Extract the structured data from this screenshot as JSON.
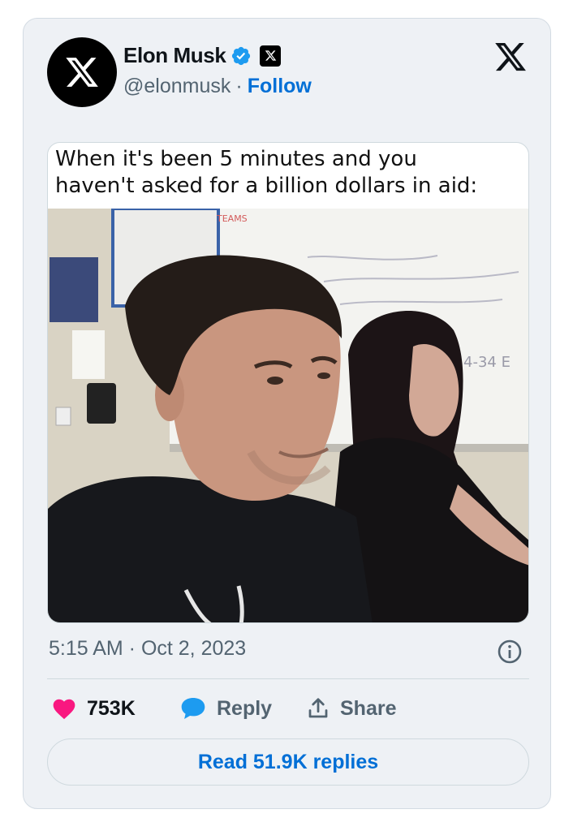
{
  "tweet": {
    "author": {
      "name": "Elon Musk",
      "handle": "@elonmusk",
      "separator": "·",
      "follow_label": "Follow",
      "avatar_icon": "x-logo-icon",
      "verified_icon": "verified-badge-icon",
      "affiliation_icon": "x-affiliation-icon"
    },
    "platform_icon": "x-logo-icon",
    "media": {
      "caption_line1": "When it's been 5 minutes and you",
      "caption_line2": "haven't asked for a billion dollars in aid:",
      "whiteboard_tag": "TEAMS",
      "whiteboard_note": "4-34 E"
    },
    "timestamp": "5:15 AM · Oct 2, 2023",
    "info_icon": "info-icon",
    "actions": {
      "like_icon": "heart-icon",
      "like_count": "753K",
      "reply_icon": "reply-bubble-icon",
      "reply_label": "Reply",
      "share_icon": "share-icon",
      "share_label": "Share"
    },
    "read_replies_label": "Read 51.9K replies"
  },
  "colors": {
    "card_bg": "#eef1f5",
    "link": "#006fd6",
    "like": "#f91880",
    "reply": "#1d9bf0",
    "verified": "#1d9bf0",
    "secondary_text": "#536471"
  }
}
